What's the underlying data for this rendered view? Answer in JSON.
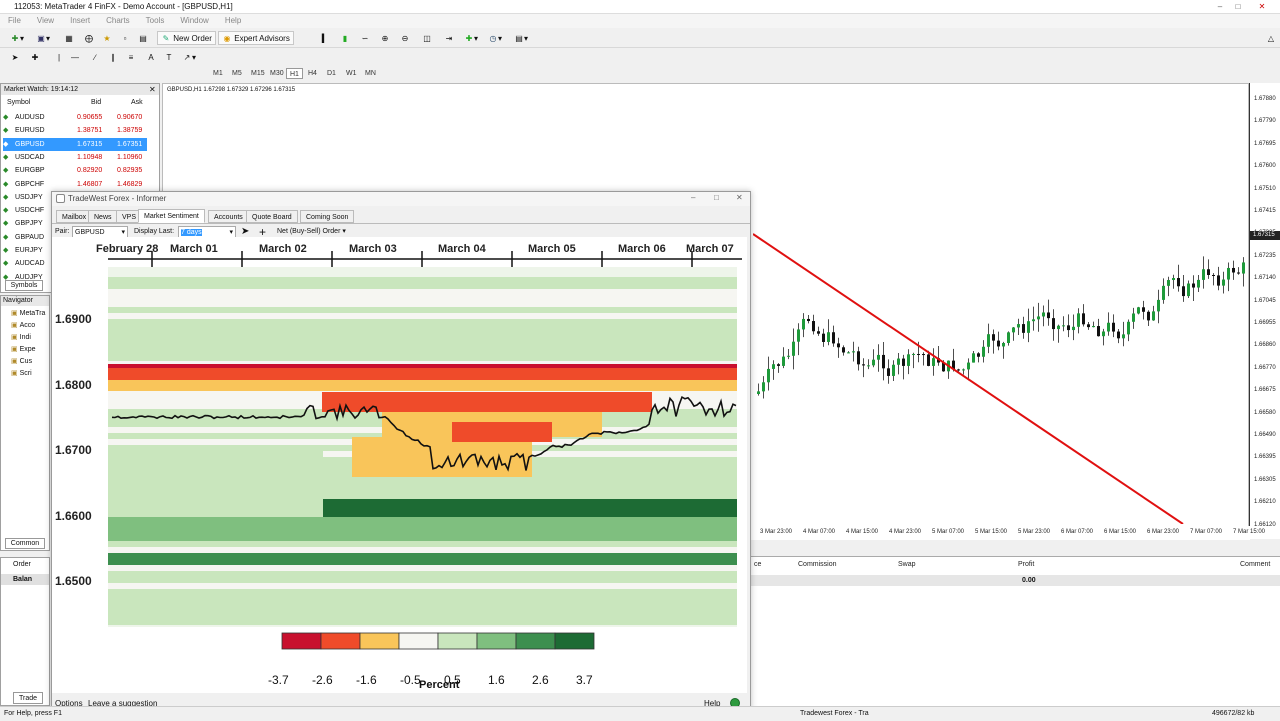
{
  "window": {
    "title": "112053: MetaTrader 4 FinFX - Demo Account - [GBPUSD,H1]"
  },
  "menu": [
    "File",
    "View",
    "Insert",
    "Charts",
    "Tools",
    "Window",
    "Help"
  ],
  "toolbar": {
    "new_order": "New Order",
    "expert_advisors": "Expert Advisors"
  },
  "timeframes": [
    "M1",
    "M5",
    "M15",
    "M30",
    "H1",
    "H4",
    "D1",
    "W1",
    "MN"
  ],
  "market_watch": {
    "title": "Market Watch: 19:14:12",
    "columns": [
      "Symbol",
      "Bid",
      "Ask"
    ],
    "rows": [
      {
        "symbol": "AUDUSD",
        "bid": "0.90655",
        "ask": "0.90670"
      },
      {
        "symbol": "EURUSD",
        "bid": "1.38751",
        "ask": "1.38759"
      },
      {
        "symbol": "GBPUSD",
        "bid": "1.67315",
        "ask": "1.67351"
      },
      {
        "symbol": "USDCAD",
        "bid": "1.10948",
        "ask": "1.10960"
      },
      {
        "symbol": "EURGBP",
        "bid": "0.82920",
        "ask": "0.82935"
      },
      {
        "symbol": "GBPCHF",
        "bid": "1.46807",
        "ask": "1.46829"
      },
      {
        "symbol": "USDJPY",
        "bid": "",
        "ask": ""
      },
      {
        "symbol": "USDCHF",
        "bid": "",
        "ask": ""
      },
      {
        "symbol": "GBPJPY",
        "bid": "",
        "ask": ""
      },
      {
        "symbol": "GBPAUD",
        "bid": "",
        "ask": ""
      },
      {
        "symbol": "EURJPY",
        "bid": "",
        "ask": ""
      },
      {
        "symbol": "AUDCAD",
        "bid": "",
        "ask": ""
      },
      {
        "symbol": "AUDJPY",
        "bid": "",
        "ask": ""
      }
    ],
    "tab": "Symbols"
  },
  "navigator": {
    "title": "Navigator",
    "items": [
      "MetaTra",
      "Acco",
      "Indi",
      "Expe",
      "Cus",
      "Scri"
    ],
    "tab": "Common"
  },
  "terminal_left": {
    "order_col": "Order",
    "balance_row": "Balan",
    "tab": "Trade"
  },
  "chart": {
    "header": "GBPUSD,H1  1.67298 1.67329 1.67296 1.67315",
    "price_ticks": [
      "1.67880",
      "1.67790",
      "1.67695",
      "1.67600",
      "1.67510",
      "1.67415",
      "1.67325",
      "1.67235",
      "1.67140",
      "1.67045",
      "1.66955",
      "1.66860",
      "1.66770",
      "1.66675",
      "1.66580",
      "1.66490",
      "1.66395",
      "1.66305",
      "1.66210",
      "1.66120"
    ],
    "current_price": "1.67315",
    "time_ticks": [
      "3 Mar 23:00",
      "4 Mar 07:00",
      "4 Mar 15:00",
      "4 Mar 23:00",
      "5 Mar 07:00",
      "5 Mar 15:00",
      "5 Mar 23:00",
      "6 Mar 07:00",
      "6 Mar 15:00",
      "6 Mar 23:00",
      "7 Mar 07:00",
      "7 Mar 15:00"
    ]
  },
  "terminal": {
    "columns": [
      "ce",
      "Commission",
      "Swap",
      "Profit",
      "Comment"
    ],
    "profit_value": "0.00"
  },
  "informer": {
    "title": "TradeWest Forex - Informer",
    "tabs": [
      "Mailbox",
      "News",
      "VPS",
      "Market Sentiment",
      "Accounts",
      "Quote Board",
      "Coming Soon"
    ],
    "active_tab": "Market Sentiment",
    "pair_label": "Pair:",
    "pair_value": "GBPUSD",
    "display_label": "Display Last:",
    "display_value": "7 days",
    "mode_value": "Net (Buy-Sell) Order",
    "x_labels": [
      "February 28",
      "March 01",
      "March 02",
      "March 03",
      "March 04",
      "March 05",
      "March 06",
      "March 07"
    ],
    "y_labels": [
      "1.6900",
      "1.6800",
      "1.6700",
      "1.6600",
      "1.6500"
    ],
    "legend_values": [
      "-3.7",
      "-2.6",
      "-1.6",
      "-0.5",
      "0.5",
      "1.6",
      "2.6",
      "3.7"
    ],
    "legend_colors": [
      "#c8102e",
      "#ef4b2a",
      "#f9c55a",
      "#f6f6f2",
      "#c9e6bd",
      "#7fbf7f",
      "#3d8f4f",
      "#1d6b34"
    ],
    "legend_title": "Percent",
    "footer_options": "Options",
    "footer_suggestion": "Leave a suggestion",
    "footer_help": "Help"
  },
  "status": {
    "left": "For Help, press F1",
    "task": "Tradewest Forex - Tra",
    "right": "496672/82 kb"
  }
}
